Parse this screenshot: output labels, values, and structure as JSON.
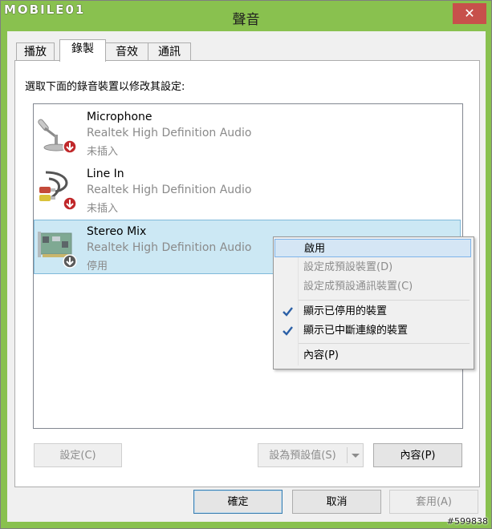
{
  "window": {
    "title": "聲音",
    "close_glyph": "✕",
    "watermark_logo": "MOBILE01"
  },
  "tabs": [
    {
      "label": "播放"
    },
    {
      "label": "錄製"
    },
    {
      "label": "音效"
    },
    {
      "label": "通訊"
    }
  ],
  "active_tab": "錄製",
  "instruction": "選取下面的錄音裝置以修改其設定:",
  "devices": [
    {
      "name": "Microphone",
      "driver": "Realtek High Definition Audio",
      "status": "未插入",
      "icon": "microphone-icon",
      "badge": "red-down-arrow-badge"
    },
    {
      "name": "Line In",
      "driver": "Realtek High Definition Audio",
      "status": "未插入",
      "icon": "line-in-cable-icon",
      "badge": "red-down-arrow-badge"
    },
    {
      "name": "Stereo Mix",
      "driver": "Realtek High Definition Audio",
      "status": "停用",
      "icon": "sound-card-icon",
      "badge": "gray-down-arrow-badge",
      "selected": true
    }
  ],
  "context_menu": {
    "items": [
      {
        "label": "啟用",
        "enabled": true,
        "highlighted": true,
        "checked": false
      },
      {
        "label": "設定成預設裝置(D)",
        "enabled": false,
        "checked": false
      },
      {
        "label": "設定成預設通訊裝置(C)",
        "enabled": false,
        "checked": false
      },
      {
        "label": "顯示已停用的裝置",
        "enabled": true,
        "checked": true
      },
      {
        "label": "顯示已中斷連線的裝置",
        "enabled": true,
        "checked": true
      },
      {
        "label": "內容(P)",
        "enabled": true,
        "checked": false
      }
    ]
  },
  "panel_buttons": {
    "configure": "設定(C)",
    "set_default": "設為預設值(S)",
    "properties": "內容(P)"
  },
  "dialog_buttons": {
    "ok": "確定",
    "cancel": "取消",
    "apply": "套用(A)"
  },
  "watermark_id": "#599838",
  "colors": {
    "title_bar": "#89c14f",
    "close_button": "#c7504b",
    "selection": "#cce8f4",
    "menu_highlight": "#d5e6f5",
    "check_mark": "#2a5fa6",
    "badge_red": "#c0282a"
  }
}
